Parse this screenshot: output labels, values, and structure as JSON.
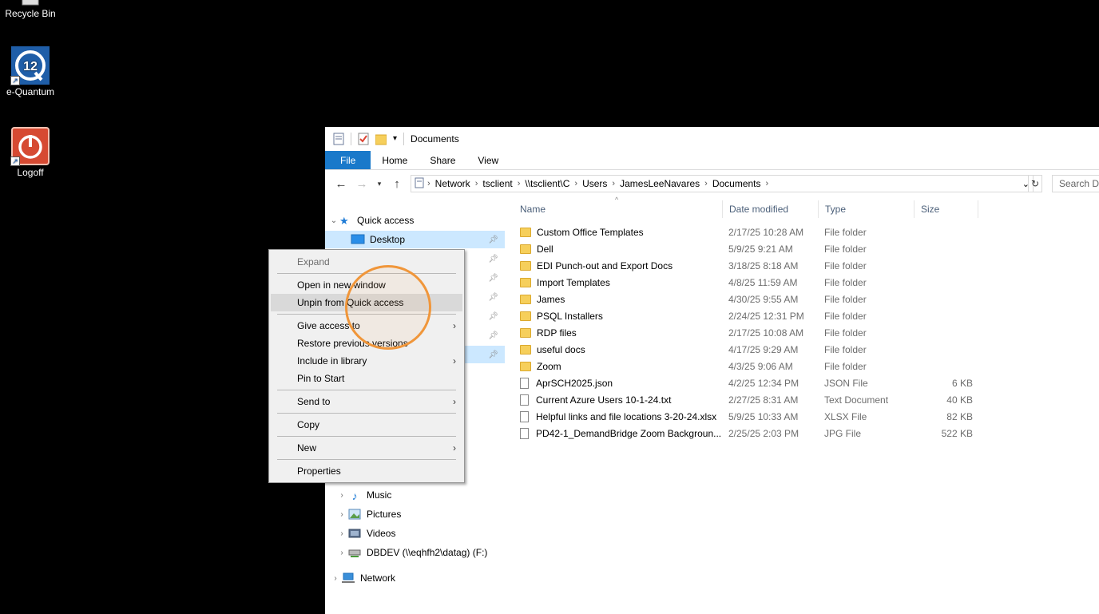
{
  "desktop": {
    "icons": [
      {
        "label": "Recycle Bin"
      },
      {
        "label": "e-Quantum"
      },
      {
        "label": "Logoff"
      }
    ]
  },
  "window": {
    "title": "Documents",
    "ribbon_tabs": [
      "File",
      "Home",
      "Share",
      "View"
    ],
    "breadcrumbs": [
      "Network",
      "tsclient",
      "\\\\tsclient\\C",
      "Users",
      "JamesLeeNavares",
      "Documents"
    ],
    "search_placeholder": "Search Do"
  },
  "navpane": {
    "quick_access": "Quick access",
    "desktop": "Desktop",
    "music": "Music",
    "pictures": "Pictures",
    "videos": "Videos",
    "dbdev": "DBDEV (\\\\eqhfh2\\datag) (F:)",
    "network": "Network"
  },
  "columns": {
    "name": "Name",
    "date": "Date modified",
    "type": "Type",
    "size": "Size"
  },
  "files": [
    {
      "name": "Custom Office Templates",
      "date": "2/17/25 10:28 AM",
      "type": "File folder",
      "size": "",
      "kind": "folder"
    },
    {
      "name": "Dell",
      "date": "5/9/25 9:21 AM",
      "type": "File folder",
      "size": "",
      "kind": "folder"
    },
    {
      "name": "EDI Punch-out and Export Docs",
      "date": "3/18/25 8:18 AM",
      "type": "File folder",
      "size": "",
      "kind": "folder"
    },
    {
      "name": "Import Templates",
      "date": "4/8/25 11:59 AM",
      "type": "File folder",
      "size": "",
      "kind": "folder"
    },
    {
      "name": "James",
      "date": "4/30/25 9:55 AM",
      "type": "File folder",
      "size": "",
      "kind": "folder"
    },
    {
      "name": "PSQL Installers",
      "date": "2/24/25 12:31 PM",
      "type": "File folder",
      "size": "",
      "kind": "folder"
    },
    {
      "name": "RDP files",
      "date": "2/17/25 10:08 AM",
      "type": "File folder",
      "size": "",
      "kind": "folder"
    },
    {
      "name": "useful docs",
      "date": "4/17/25 9:29 AM",
      "type": "File folder",
      "size": "",
      "kind": "folder"
    },
    {
      "name": "Zoom",
      "date": "4/3/25 9:06 AM",
      "type": "File folder",
      "size": "",
      "kind": "folder"
    },
    {
      "name": "AprSCH2025.json",
      "date": "4/2/25 12:34 PM",
      "type": "JSON File",
      "size": "6 KB",
      "kind": "file"
    },
    {
      "name": "Current Azure Users 10-1-24.txt",
      "date": "2/27/25 8:31 AM",
      "type": "Text Document",
      "size": "40 KB",
      "kind": "file"
    },
    {
      "name": "Helpful links and file locations 3-20-24.xlsx",
      "date": "5/9/25 10:33 AM",
      "type": "XLSX File",
      "size": "82 KB",
      "kind": "file"
    },
    {
      "name": "PD42-1_DemandBridge Zoom Backgroun...",
      "date": "2/25/25 2:03 PM",
      "type": "JPG File",
      "size": "522 KB",
      "kind": "image"
    }
  ],
  "context_menu": {
    "expand": "Expand",
    "open_new_window": "Open in new window",
    "unpin": "Unpin from Quick access",
    "give_access": "Give access to",
    "restore": "Restore previous versions",
    "include_library": "Include in library",
    "pin_start": "Pin to Start",
    "send_to": "Send to",
    "copy": "Copy",
    "new": "New",
    "properties": "Properties"
  }
}
